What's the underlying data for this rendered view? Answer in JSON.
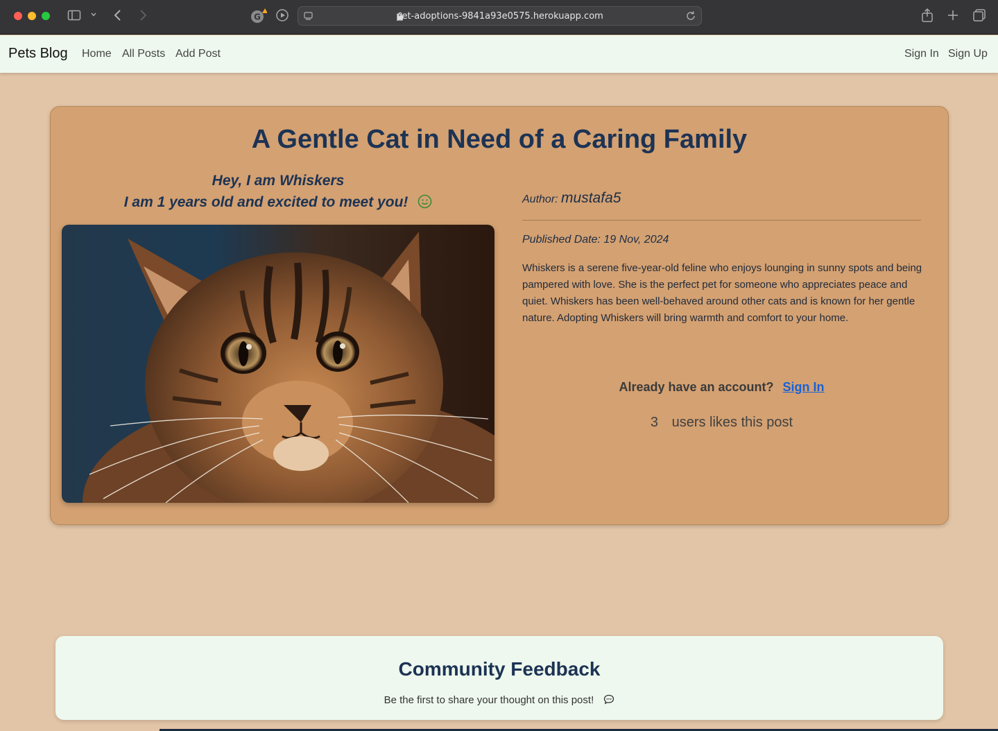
{
  "browser": {
    "url": "pet-adoptions-9841a93e0575.herokuapp.com"
  },
  "navbar": {
    "brand": "Pets Blog",
    "links": [
      {
        "label": "Home"
      },
      {
        "label": "All Posts"
      },
      {
        "label": "Add Post"
      }
    ],
    "auth_links": [
      {
        "label": "Sign In"
      },
      {
        "label": "Sign Up"
      }
    ]
  },
  "post": {
    "title": "A Gentle Cat in Need of a Caring Family",
    "greeting_line1": "Hey, I am Whiskers",
    "greeting_line2": "I am 1 years old and excited to meet you!",
    "author_label": "Author:",
    "author_name": "mustafa5",
    "published_date": "Published Date: 19 Nov, 2024",
    "description": "Whiskers is a serene five-year-old feline who enjoys lounging in sunny spots and being pampered with love. She is the perfect pet for someone who appreciates peace and quiet. Whiskers has been well-behaved around other cats and is known for her gentle nature. Adopting Whiskers will bring warmth and comfort to your home.",
    "account_prompt": "Already have an account?",
    "sign_in_link": "Sign In",
    "likes_count": "3",
    "likes_text": "users likes this post"
  },
  "feedback": {
    "title": "Community Feedback",
    "empty_text": "Be the first to share your thought on this post!"
  },
  "colors": {
    "page_bg": "#e2c4a6",
    "card_bg": "#d4a172",
    "heading": "#1c3354",
    "navbar_bg": "#eef8ee",
    "link_blue": "#1a62d4"
  }
}
